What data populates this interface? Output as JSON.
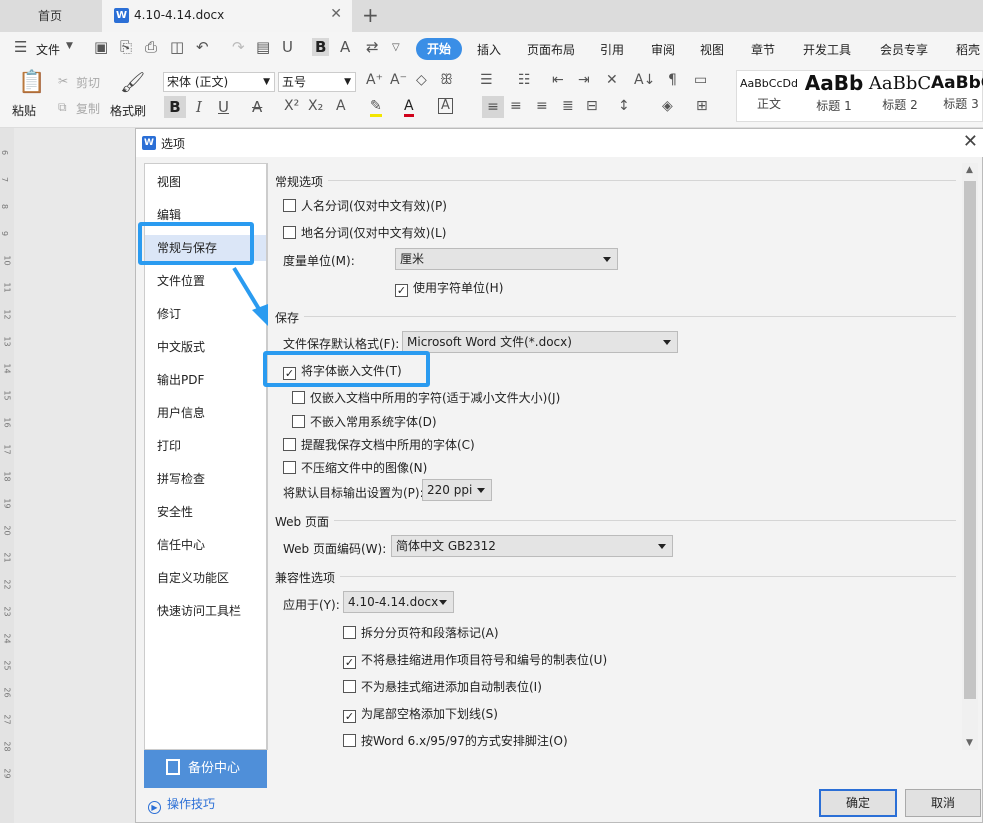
{
  "tabs": {
    "home": "首页",
    "doc": "4.10-4.14.docx",
    "doc_icon": "W",
    "new_tab": "+"
  },
  "menu": {
    "file": "文件",
    "items": [
      "开始",
      "插入",
      "页面布局",
      "引用",
      "审阅",
      "视图",
      "章节",
      "开发工具",
      "会员专享",
      "稻壳"
    ]
  },
  "ribbon": {
    "paste": "粘贴",
    "cut": "剪切",
    "copy": "复制",
    "format_painter": "格式刷",
    "font_name": "宋体 (正文)",
    "font_size": "五号",
    "styles": [
      {
        "preview": "AaBbCcDd",
        "label": "正文"
      },
      {
        "preview": "AaBb",
        "label": "标题 1"
      },
      {
        "preview": "AaBbC",
        "label": "标题 2"
      },
      {
        "preview": "AaBbC",
        "label": "标题 3"
      }
    ]
  },
  "ruler_ticks": [
    "6",
    "7",
    "8",
    "9",
    "10",
    "11",
    "12",
    "13",
    "14",
    "15",
    "16",
    "17",
    "18",
    "19",
    "20",
    "21",
    "22",
    "23",
    "24",
    "25",
    "26",
    "27",
    "28",
    "29"
  ],
  "dialog": {
    "title": "选项",
    "icon": "W",
    "nav": [
      "视图",
      "编辑",
      "常规与保存",
      "文件位置",
      "修订",
      "中文版式",
      "输出PDF",
      "用户信息",
      "打印",
      "拼写检查",
      "安全性",
      "信任中心",
      "自定义功能区",
      "快速访问工具栏"
    ],
    "active_nav": "常规与保存",
    "backup": "备份中心",
    "tips": "操作技巧",
    "general": {
      "title": "常规选项",
      "person_seg": "人名分词(仅对中文有效)(P)",
      "place_seg": "地名分词(仅对中文有效)(L)",
      "unit_label": "度量单位(M):",
      "unit_value": "厘米",
      "char_unit": "使用字符单位(H)"
    },
    "save": {
      "title": "保存",
      "format_label": "文件保存默认格式(F):",
      "format_value": "Microsoft Word 文件(*.docx)",
      "embed_fonts": "将字体嵌入文件(T)",
      "embed_used_only": "仅嵌入文档中所用的字符(适于减小文件大小)(J)",
      "no_common_fonts": "不嵌入常用系统字体(D)",
      "remind_fonts": "提醒我保存文档中所用的字体(C)",
      "no_compress": "不压缩文件中的图像(N)",
      "resolution_label": "将默认目标输出设置为(P):",
      "resolution_value": "220 ppi"
    },
    "web": {
      "title": "Web 页面",
      "encoding_label": "Web 页面编码(W):",
      "encoding_value": "简体中文 GB2312"
    },
    "compat": {
      "title": "兼容性选项",
      "apply_label": "应用于(Y):",
      "apply_value": "4.10-4.14.docx",
      "opt1": "拆分分页符和段落标记(A)",
      "opt2": "不将悬挂缩进用作项目符号和编号的制表位(U)",
      "opt3": "不为悬挂式缩进添加自动制表位(I)",
      "opt4": "为尾部空格添加下划线(S)",
      "opt5": "按Word 6.x/95/97的方式安排脚注(O)"
    },
    "ok": "确定",
    "cancel": "取消"
  },
  "accent_color": "#2a9bf0"
}
